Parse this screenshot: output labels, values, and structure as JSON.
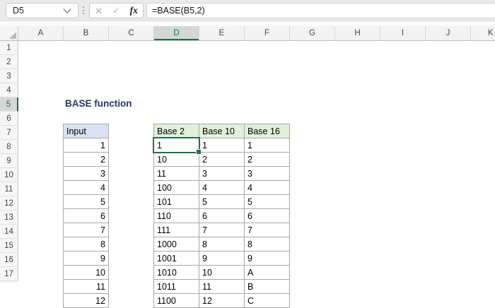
{
  "formula_bar": {
    "name_box_value": "D5",
    "cancel_label": "✕",
    "enter_label": "✓",
    "fx_label": "fx",
    "formula": "=BASE(B5,2)"
  },
  "grid": {
    "column_headers": [
      "A",
      "B",
      "C",
      "D",
      "E",
      "F",
      "G",
      "H",
      "I",
      "J",
      "K"
    ],
    "selected_column": "D",
    "row_headers": [
      "1",
      "2",
      "3",
      "4",
      "5",
      "6",
      "7",
      "8",
      "9",
      "10",
      "11",
      "12",
      "13",
      "14",
      "15",
      "16",
      "17"
    ],
    "selected_row": "5",
    "active_cell": "D5"
  },
  "content": {
    "title": "BASE function",
    "input_table": {
      "header": "Input",
      "values": [
        "1",
        "2",
        "3",
        "4",
        "5",
        "6",
        "7",
        "8",
        "9",
        "10",
        "11",
        "12"
      ]
    },
    "base_table": {
      "headers": [
        "Base 2",
        "Base 10",
        "Base 16"
      ],
      "rows": [
        [
          "1",
          "1",
          "1"
        ],
        [
          "10",
          "2",
          "2"
        ],
        [
          "11",
          "3",
          "3"
        ],
        [
          "100",
          "4",
          "4"
        ],
        [
          "101",
          "5",
          "5"
        ],
        [
          "110",
          "6",
          "6"
        ],
        [
          "111",
          "7",
          "7"
        ],
        [
          "1000",
          "8",
          "8"
        ],
        [
          "1001",
          "9",
          "9"
        ],
        [
          "1010",
          "10",
          "A"
        ],
        [
          "1011",
          "11",
          "B"
        ],
        [
          "1100",
          "12",
          "C"
        ]
      ]
    }
  },
  "colors": {
    "selection_green": "#1E7145",
    "header_selected_fill": "#D6D6D6",
    "input_header_fill": "#D9E1F2",
    "base_header_fill": "#E2EFDA",
    "title_color": "#203864",
    "table_border": "#A8A8A8"
  }
}
